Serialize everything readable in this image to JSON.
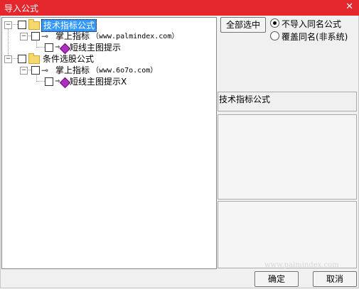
{
  "window": {
    "title": "导入公式",
    "close_glyph": "✕"
  },
  "tree": {
    "nodes": [
      {
        "label": "技术指标公式",
        "selected": true
      },
      {
        "label": "掌上指标",
        "url": "（www.palmindex.com）"
      },
      {
        "label": "短线主图提示"
      },
      {
        "label": "条件选股公式"
      },
      {
        "label": "掌上指标",
        "url": "（www.6o7o.com）"
      },
      {
        "label": "短线主图提示X"
      }
    ],
    "toggle_glyph": "−"
  },
  "buttons": {
    "select_all": "全部选中",
    "ok": "确定",
    "cancel": "取消"
  },
  "options": {
    "no_import_same": "不导入同名公式",
    "overwrite_same": "覆盖同名(非系统)",
    "selected": "no_import_same"
  },
  "info": {
    "text": "技术指标公式"
  },
  "watermark": "www.palmindex.com"
}
